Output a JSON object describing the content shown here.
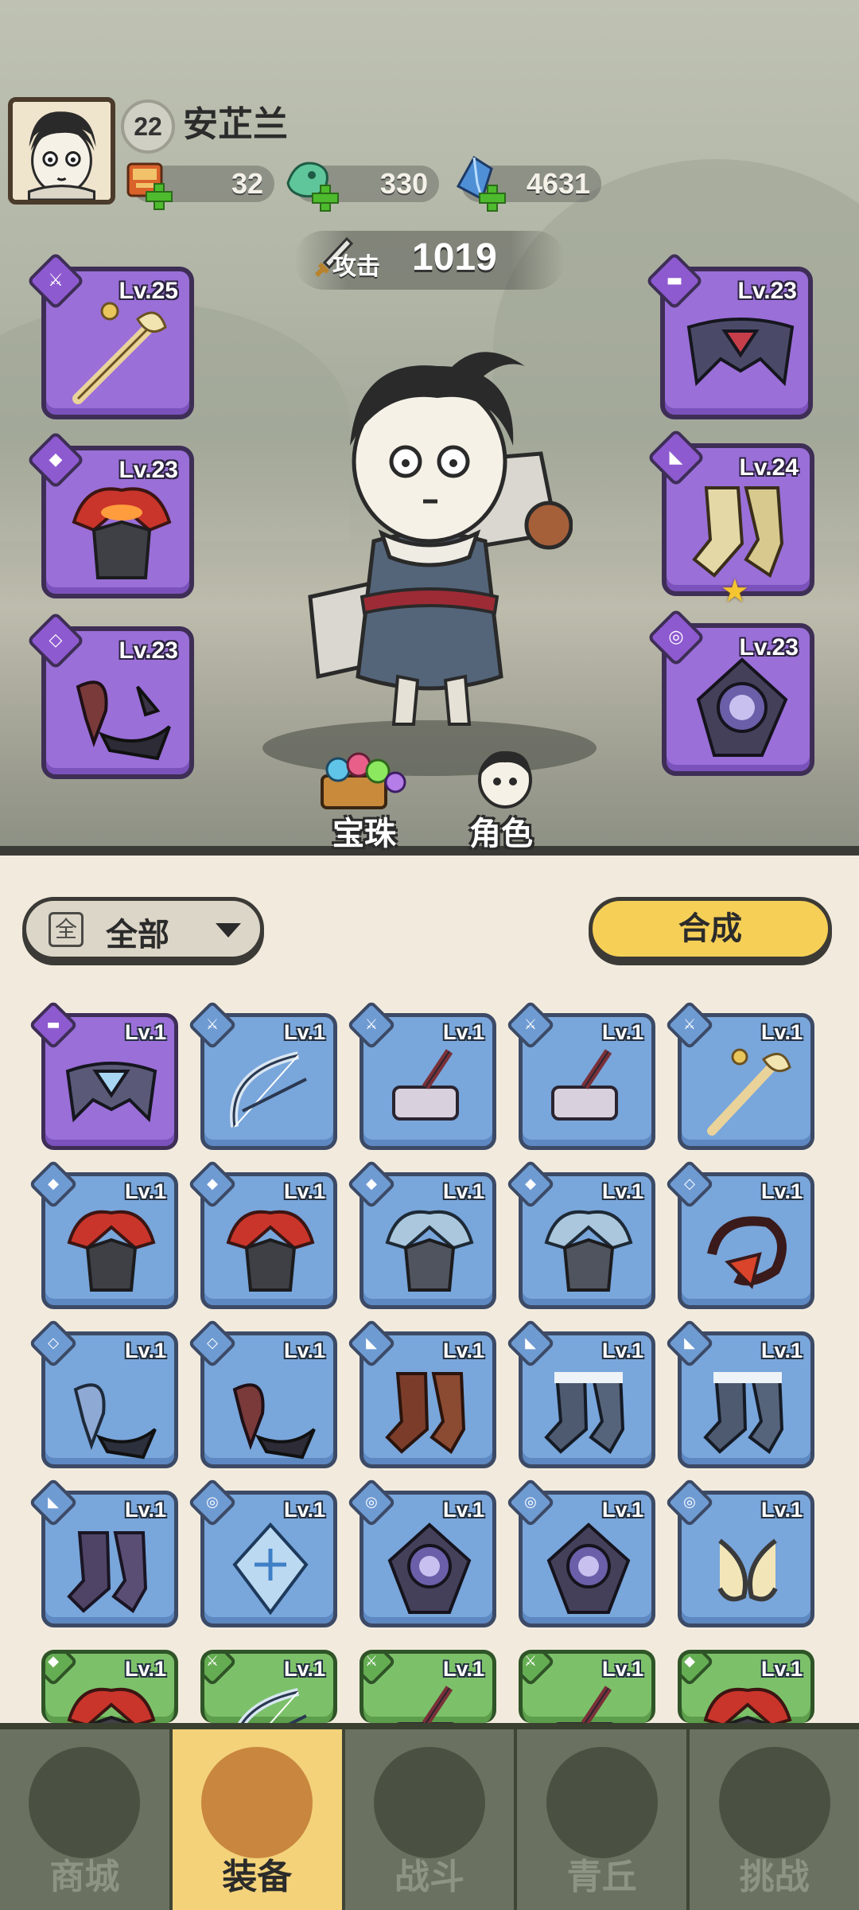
{
  "player": {
    "level": "22",
    "name": "安芷兰"
  },
  "resources": [
    {
      "name": "scroll",
      "value": "32"
    },
    {
      "name": "jade",
      "value": "330"
    },
    {
      "name": "crystal",
      "value": "4631"
    }
  ],
  "attack": {
    "label": "攻击",
    "value": "1019"
  },
  "equipped": [
    {
      "slot": "weapon",
      "level": "Lv.25"
    },
    {
      "slot": "helmet",
      "level": "Lv.23"
    },
    {
      "slot": "armor",
      "level": "Lv.23"
    },
    {
      "slot": "belt",
      "level": "Lv.23"
    },
    {
      "slot": "boots",
      "level": "Lv.24",
      "starred": true
    },
    {
      "slot": "amulet",
      "level": "Lv.23"
    }
  ],
  "hero_links": {
    "gems": "宝珠",
    "character": "角色"
  },
  "inventory": {
    "filter_label": "全部",
    "filter_icon": "全",
    "synth_label": "合成",
    "items": [
      {
        "level": "Lv.1",
        "color": "purple",
        "icon": "belt"
      },
      {
        "level": "Lv.1",
        "color": "blue",
        "icon": "bow"
      },
      {
        "level": "Lv.1",
        "color": "blue",
        "icon": "hammer"
      },
      {
        "level": "Lv.1",
        "color": "blue",
        "icon": "hammer"
      },
      {
        "level": "Lv.1",
        "color": "blue",
        "icon": "staff"
      },
      {
        "level": "Lv.1",
        "color": "blue",
        "icon": "helmet-red"
      },
      {
        "level": "Lv.1",
        "color": "blue",
        "icon": "helmet-red"
      },
      {
        "level": "Lv.1",
        "color": "blue",
        "icon": "helmet-ice"
      },
      {
        "level": "Lv.1",
        "color": "blue",
        "icon": "helmet-ice"
      },
      {
        "level": "Lv.1",
        "color": "blue",
        "icon": "ring-red"
      },
      {
        "level": "Lv.1",
        "color": "blue",
        "icon": "armor-blue"
      },
      {
        "level": "Lv.1",
        "color": "blue",
        "icon": "armor-dark"
      },
      {
        "level": "Lv.1",
        "color": "blue",
        "icon": "boots-brown"
      },
      {
        "level": "Lv.1",
        "color": "blue",
        "icon": "boots-ice"
      },
      {
        "level": "Lv.1",
        "color": "blue",
        "icon": "boots-ice"
      },
      {
        "level": "Lv.1",
        "color": "blue",
        "icon": "boots-purple"
      },
      {
        "level": "Lv.1",
        "color": "blue",
        "icon": "amulet-blue"
      },
      {
        "level": "Lv.1",
        "color": "blue",
        "icon": "amulet-dark"
      },
      {
        "level": "Lv.1",
        "color": "blue",
        "icon": "amulet-dark"
      },
      {
        "level": "Lv.1",
        "color": "blue",
        "icon": "claws"
      },
      {
        "level": "Lv.1",
        "color": "green",
        "icon": "helmet-red"
      },
      {
        "level": "Lv.1",
        "color": "green",
        "icon": "bow"
      },
      {
        "level": "Lv.1",
        "color": "green",
        "icon": "hammer"
      },
      {
        "level": "Lv.1",
        "color": "green",
        "icon": "hammer"
      },
      {
        "level": "Lv.1",
        "color": "green",
        "icon": "helmet-red"
      }
    ]
  },
  "nav": [
    {
      "label": "商城",
      "active": false
    },
    {
      "label": "装备",
      "active": true
    },
    {
      "label": "战斗",
      "active": false
    },
    {
      "label": "青丘",
      "active": false
    },
    {
      "label": "挑战",
      "active": false
    }
  ]
}
